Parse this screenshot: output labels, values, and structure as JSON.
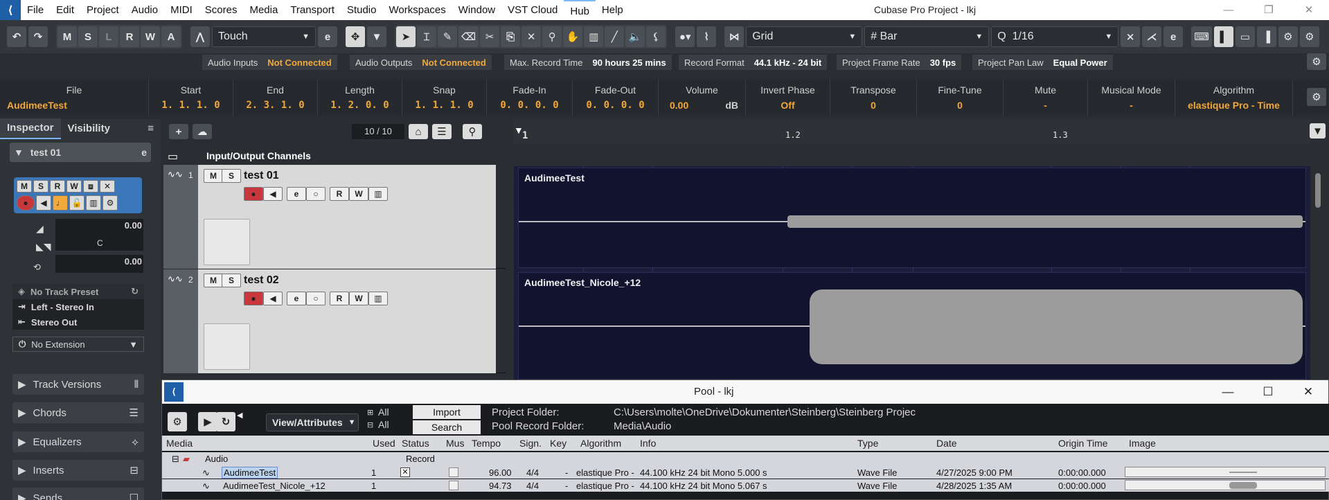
{
  "menubar": {
    "items": [
      "File",
      "Edit",
      "Project",
      "Audio",
      "MIDI",
      "Scores",
      "Media",
      "Transport",
      "Studio",
      "Workspaces",
      "Window",
      "VST Cloud",
      "Hub",
      "Help"
    ],
    "title": "Cubase Pro Project - lkj"
  },
  "toolbar": {
    "mode_buttons": [
      "M",
      "S",
      "L",
      "R",
      "W",
      "A"
    ],
    "automation_mode": "Touch",
    "snap_type": "Grid",
    "grid_type": "Bar",
    "quantize": "1/16"
  },
  "status": {
    "audio_inputs_label": "Audio Inputs",
    "audio_inputs_value": "Not Connected",
    "audio_outputs_label": "Audio Outputs",
    "audio_outputs_value": "Not Connected",
    "max_record_label": "Max. Record Time",
    "max_record_value": "90 hours 25 mins",
    "record_format_label": "Record Format",
    "record_format_value": "44.1 kHz - 24 bit",
    "frame_rate_label": "Project Frame Rate",
    "frame_rate_value": "30 fps",
    "pan_law_label": "Project Pan Law",
    "pan_law_value": "Equal Power"
  },
  "infoline": {
    "columns": [
      {
        "h": "File",
        "v": "AudimeeTest"
      },
      {
        "h": "Start",
        "v": "1. 1. 1.   0"
      },
      {
        "h": "End",
        "v": "2. 3. 1.   0"
      },
      {
        "h": "Length",
        "v": "1. 2. 0.   0"
      },
      {
        "h": "Snap",
        "v": "1. 1. 1.   0"
      },
      {
        "h": "Fade-In",
        "v": "0. 0. 0.   0"
      },
      {
        "h": "Fade-Out",
        "v": "0. 0. 0.   0"
      },
      {
        "h": "Volume",
        "v": "0.00",
        "unit": "dB"
      },
      {
        "h": "Invert Phase",
        "v": "Off"
      },
      {
        "h": "Transpose",
        "v": "0"
      },
      {
        "h": "Fine-Tune",
        "v": "0"
      },
      {
        "h": "Mute",
        "v": "-"
      },
      {
        "h": "Musical Mode",
        "v": "-"
      },
      {
        "h": "Algorithm",
        "v": "elastique Pro - Time"
      }
    ]
  },
  "inspector": {
    "tab_inspector": "Inspector",
    "tab_visibility": "Visibility",
    "track_name": "test 01",
    "volume": "0.00",
    "pan": "C",
    "delay": "0.00",
    "track_preset": "No Track Preset",
    "input_routing": "Left - Stereo In",
    "output_routing": "Stereo Out",
    "extension": "No Extension",
    "sections": [
      "Track Versions",
      "Chords",
      "Equalizers",
      "Inserts",
      "Sends"
    ]
  },
  "tracklist": {
    "counter": "10 / 10",
    "folder_name": "Input/Output Channels",
    "tracks": [
      {
        "num": "1",
        "name": "test 01"
      },
      {
        "num": "2",
        "name": "test 02"
      }
    ]
  },
  "ruler": {
    "marks": [
      "1",
      "1.2",
      "1.3"
    ]
  },
  "events": [
    {
      "name": "AudimeeTest"
    },
    {
      "name": "AudimeeTest_Nicole_+12"
    }
  ],
  "pool": {
    "title": "Pool - lkj",
    "view_attributes": "View/Attributes",
    "all_1": "All",
    "all_2": "All",
    "import_label": "Import",
    "search_label": "Search",
    "project_folder_label": "Project Folder:",
    "project_folder_value": "C:\\Users\\molte\\OneDrive\\Dokumenter\\Steinberg\\Steinberg Projec",
    "record_folder_label": "Pool Record Folder:",
    "record_folder_value": "Media\\Audio",
    "columns": [
      "Media",
      "Used",
      "Status",
      "Mus",
      "Tempo",
      "Sign.",
      "Key",
      "Algorithm",
      "Info",
      "Type",
      "Date",
      "Origin Time",
      "Image"
    ],
    "group_name": "Audio",
    "group_status": "Record",
    "rows": [
      {
        "media": "AudimeeTest",
        "used": "1",
        "tempo": "96.00",
        "sign": "4/4",
        "key": "-",
        "algorithm": "elastique Pro -",
        "info": "44.100 kHz   24 bit  Mono  5.000 s",
        "type": "Wave File",
        "date": "4/27/2025    9:00 PM",
        "origin": "0:00:00.000"
      },
      {
        "media": "AudimeeTest_Nicole_+12",
        "used": "1",
        "tempo": "94.73",
        "sign": "4/4",
        "key": "-",
        "algorithm": "elastique Pro -",
        "info": "44.100 kHz   24 bit  Mono  5.067 s",
        "type": "Wave File",
        "date": "4/28/2025    1:35 AM",
        "origin": "0:00:00.000"
      }
    ]
  },
  "colors": {
    "accent_orange": "#f2a83b",
    "record_red": "#c7373b",
    "inspector_blue": "#3a76b8",
    "arrange_bg": "#1c1d3a"
  }
}
